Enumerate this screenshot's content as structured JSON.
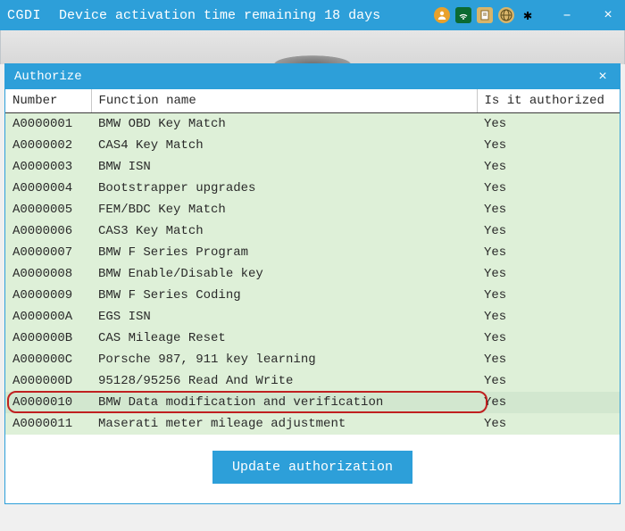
{
  "titlebar": {
    "app_name": "CGDI",
    "status_text": "Device activation time remaining 18 days"
  },
  "icons": {
    "user": "user-icon",
    "wifi": "wifi-icon",
    "doc": "doc-icon",
    "globe": "globe-icon",
    "gear": "settings-icon",
    "minimize": "–",
    "close": "×",
    "dlg_close": "×"
  },
  "dialog": {
    "title": "Authorize",
    "columns": {
      "number": "Number",
      "function_name": "Function name",
      "authorized": "Is it authorized"
    },
    "rows": [
      {
        "num": "A0000001",
        "fn": "BMW OBD Key Match",
        "auth": "Yes"
      },
      {
        "num": "A0000002",
        "fn": "CAS4 Key Match",
        "auth": "Yes"
      },
      {
        "num": "A0000003",
        "fn": "BMW ISN",
        "auth": "Yes"
      },
      {
        "num": "A0000004",
        "fn": "Bootstrapper upgrades",
        "auth": "Yes"
      },
      {
        "num": "A0000005",
        "fn": "FEM/BDC Key Match",
        "auth": "Yes"
      },
      {
        "num": "A0000006",
        "fn": "CAS3 Key Match",
        "auth": "Yes"
      },
      {
        "num": "A0000007",
        "fn": "BMW F Series Program",
        "auth": "Yes"
      },
      {
        "num": "A0000008",
        "fn": "BMW Enable/Disable key",
        "auth": "Yes"
      },
      {
        "num": "A0000009",
        "fn": "BMW F Series Coding",
        "auth": "Yes"
      },
      {
        "num": "A000000A",
        "fn": "EGS ISN",
        "auth": "Yes"
      },
      {
        "num": "A000000B",
        "fn": "CAS Mileage Reset",
        "auth": "Yes"
      },
      {
        "num": "A000000C",
        "fn": "Porsche 987, 911 key learning",
        "auth": "Yes"
      },
      {
        "num": "A000000D",
        "fn": "95128/95256 Read And Write",
        "auth": "Yes"
      },
      {
        "num": "A0000010",
        "fn": "BMW Data modification and verification",
        "auth": "Yes",
        "highlight": true
      },
      {
        "num": "A0000011",
        "fn": "Maserati meter mileage adjustment",
        "auth": "Yes"
      }
    ],
    "update_button": "Update authorization"
  },
  "colors": {
    "accent": "#2d9fd9",
    "row_bg": "#def0d8",
    "highlight_ring": "#c02020"
  }
}
